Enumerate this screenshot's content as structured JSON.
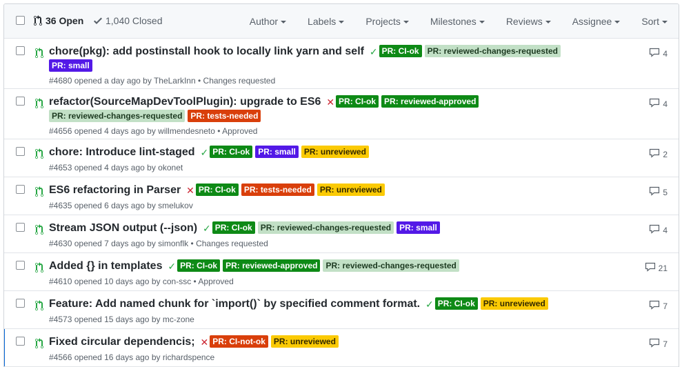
{
  "header": {
    "open_label": "36 Open",
    "closed_label": "1,040 Closed",
    "filters": [
      "Author",
      "Labels",
      "Projects",
      "Milestones",
      "Reviews",
      "Assignee",
      "Sort"
    ]
  },
  "colors": {
    "ci_ok": "#0e8a16",
    "ci_not_ok": "#d93f0b",
    "reviewed_changes_requested": "#c2e0c6",
    "reviewed_approved": "#0e8a16",
    "tests_needed": "#d93f0b",
    "small": "#5319e7",
    "unreviewed": "#fbca04",
    "accent": "#0366d6"
  },
  "issues": [
    {
      "title": "chore(pkg): add postinstall hook to locally link yarn and self",
      "status": "✓",
      "labels": [
        "PR: CI-ok",
        "PR: reviewed-changes-requested",
        "PR: small"
      ],
      "number": "#4680",
      "opened": "opened a day ago by",
      "author": "TheLarkInn",
      "review": "• Changes requested",
      "comments": "4"
    },
    {
      "title": "refactor(SourceMapDevToolPlugin): upgrade to ES6",
      "status": "✕",
      "labels": [
        "PR: CI-ok",
        "PR: reviewed-approved",
        "PR: reviewed-changes-requested",
        "PR: tests-needed"
      ],
      "number": "#4656",
      "opened": "opened 4 days ago by",
      "author": "willmendesneto",
      "review": "• Approved",
      "comments": "4"
    },
    {
      "title": "chore: Introduce lint-staged",
      "status": "✓",
      "labels": [
        "PR: CI-ok",
        "PR: small",
        "PR: unreviewed"
      ],
      "number": "#4653",
      "opened": "opened 4 days ago by",
      "author": "okonet",
      "review": "",
      "comments": "2"
    },
    {
      "title": "ES6 refactoring in Parser",
      "status": "✕",
      "labels": [
        "PR: CI-ok",
        "PR: tests-needed",
        "PR: unreviewed"
      ],
      "number": "#4635",
      "opened": "opened 6 days ago by",
      "author": "smelukov",
      "review": "",
      "comments": "5"
    },
    {
      "title": "Stream JSON output (--json)",
      "status": "✓",
      "labels": [
        "PR: CI-ok",
        "PR: reviewed-changes-requested",
        "PR: small"
      ],
      "number": "#4630",
      "opened": "opened 7 days ago by",
      "author": "simonflk",
      "review": "• Changes requested",
      "comments": "4"
    },
    {
      "title": "Added {} in templates",
      "status": "✓",
      "labels": [
        "PR: CI-ok",
        "PR: reviewed-approved",
        "PR: reviewed-changes-requested"
      ],
      "number": "#4610",
      "opened": "opened 10 days ago by",
      "author": "con-ssc",
      "review": "• Approved",
      "comments": "21"
    },
    {
      "title": "Feature: Add named chunk for `import()` by specified comment format.",
      "status": "✓",
      "labels": [
        "PR: CI-ok",
        "PR: unreviewed"
      ],
      "number": "#4573",
      "opened": "opened 15 days ago by",
      "author": "mc-zone",
      "review": "",
      "comments": "7"
    },
    {
      "title": "Fixed circular dependencis;",
      "status": "✕",
      "labels": [
        "PR: CI-not-ok",
        "PR: unreviewed"
      ],
      "number": "#4566",
      "opened": "opened 16 days ago by",
      "author": "richardspence",
      "review": "",
      "comments": "7"
    }
  ]
}
